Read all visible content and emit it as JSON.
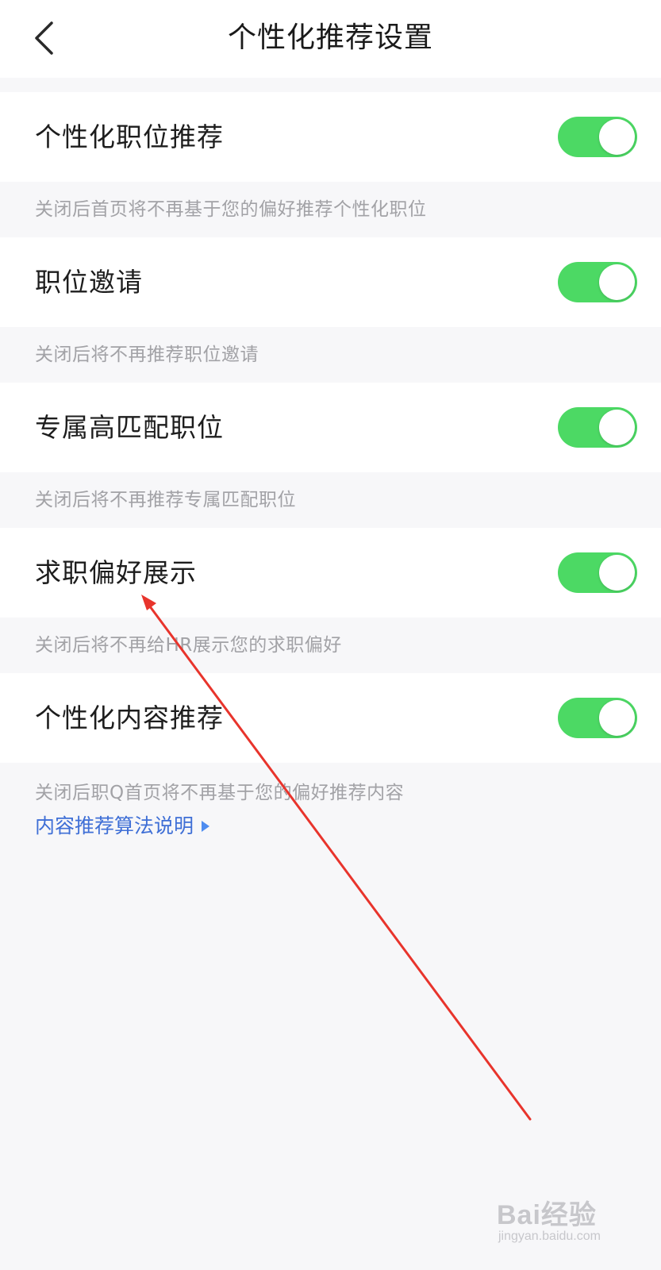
{
  "header": {
    "title": "个性化推荐设置",
    "back_icon": "chevron-left-icon"
  },
  "settings": [
    {
      "label": "个性化职位推荐",
      "enabled": true,
      "description": "关闭后首页将不再基于您的偏好推荐个性化职位"
    },
    {
      "label": "职位邀请",
      "enabled": true,
      "description": "关闭后将不再推荐职位邀请"
    },
    {
      "label": "专属高匹配职位",
      "enabled": true,
      "description": "关闭后将不再推荐专属匹配职位"
    },
    {
      "label": "求职偏好展示",
      "enabled": true,
      "description": "关闭后将不再给HR展示您的求职偏好"
    },
    {
      "label": "个性化内容推荐",
      "enabled": true,
      "description": "关闭后职Q首页将不再基于您的偏好推荐内容"
    }
  ],
  "footer_link": {
    "label": "内容推荐算法说明"
  },
  "watermark": {
    "main": "Bai经验",
    "sub": "jingyan.baidu.com"
  },
  "colors": {
    "toggle_on": "#4cd964",
    "link": "#3f6fd6",
    "annotation_arrow": "#e8342c"
  }
}
